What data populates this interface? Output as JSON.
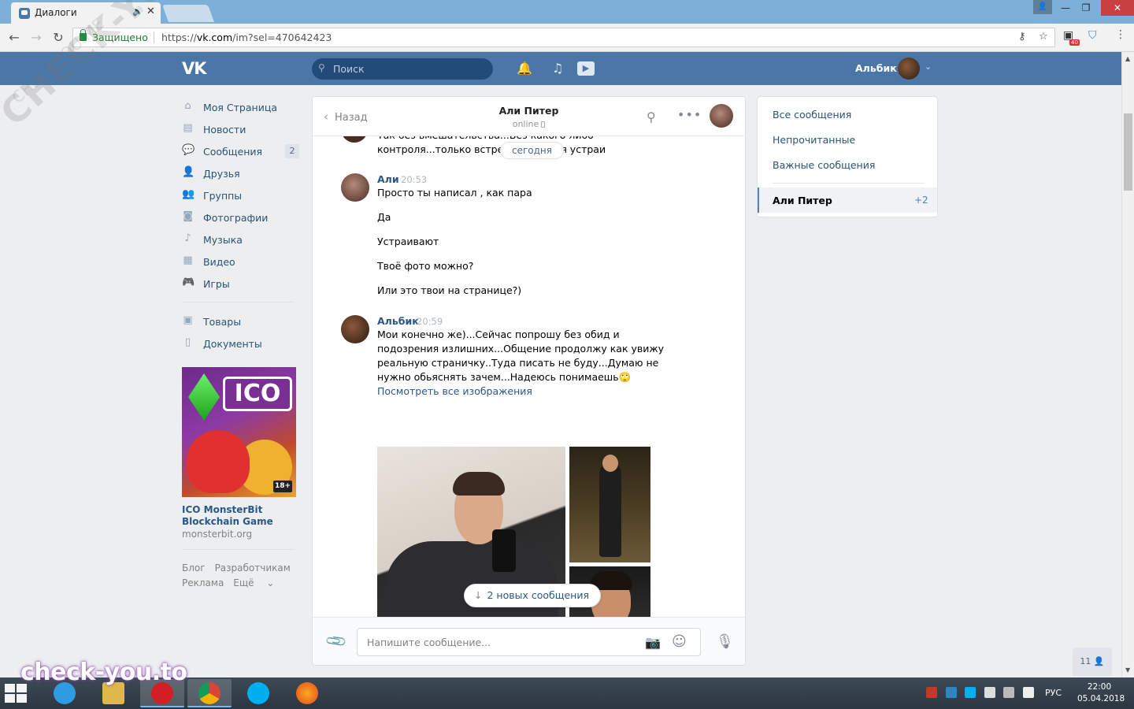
{
  "browser": {
    "tab_title": "Диалоги",
    "security_label": "Защищено",
    "url_scheme": "https://",
    "url_host": "vk.com",
    "url_path": "/im?sel=470642423",
    "extension_badge": "40"
  },
  "header": {
    "logo": "VK",
    "search_placeholder": "Поиск",
    "user_name": "Альбик"
  },
  "sidebar": {
    "items": [
      {
        "label": "Моя Страница",
        "icon": "home-icon"
      },
      {
        "label": "Новости",
        "icon": "news-icon"
      },
      {
        "label": "Сообщения",
        "icon": "messages-icon",
        "badge": "2"
      },
      {
        "label": "Друзья",
        "icon": "friends-icon"
      },
      {
        "label": "Группы",
        "icon": "groups-icon"
      },
      {
        "label": "Фотографии",
        "icon": "camera-icon"
      },
      {
        "label": "Музыка",
        "icon": "music-icon"
      },
      {
        "label": "Видео",
        "icon": "video-icon"
      },
      {
        "label": "Игры",
        "icon": "gamepad-icon"
      }
    ],
    "items2": [
      {
        "label": "Товары",
        "icon": "bag-icon"
      },
      {
        "label": "Документы",
        "icon": "document-icon"
      }
    ],
    "ad": {
      "banner_text": "ICO",
      "age": "18+",
      "title": "ICO MonsterBit Blockchain Game",
      "domain": "monsterbit.org"
    },
    "footer": {
      "blog": "Блог",
      "developers": "Разработчикам",
      "ads": "Реклама",
      "more": "Ещё"
    }
  },
  "dialog": {
    "back_label": "Назад",
    "peer_name": "Али Питер",
    "peer_status": "online",
    "cutoff_text": "Так без вмешательства...Без какого либо контроля...только встречи...Условия устраи",
    "date_divider": "сегодня",
    "messages": [
      {
        "author": "Али",
        "time": "20:53",
        "lines": [
          "Просто ты написал , как пара",
          "Да",
          "Устраивают",
          "Твоё фото можно?",
          "Или это твои на странице?)"
        ]
      },
      {
        "author": "Альбик",
        "time": "20:59",
        "text": "Мои конечно же)...Сейчас попрошу без обид и подозрения излишних...Общение продолжу как увижу реальную страничку..Туда писать не буду...Думаю не нужно обьяснять зачем...Надеюсь понимаешь",
        "emoji": "🙄",
        "link": "Посмотреть все изображения"
      }
    ],
    "new_messages": "2 новых сообщения",
    "input_placeholder": "Напишите сообщение..."
  },
  "right_menu": {
    "all": "Все сообщения",
    "unread": "Непрочитанные",
    "important": "Важные сообщения",
    "active_chat": "Али Питер",
    "active_count": "+2"
  },
  "friends_online": "11",
  "taskbar": {
    "language": "РУС",
    "time": "22:00",
    "date": "05.04.2018"
  },
  "watermarks": {
    "diagonal": "CHECK-YOU.ME",
    "site": "check-you.to"
  }
}
